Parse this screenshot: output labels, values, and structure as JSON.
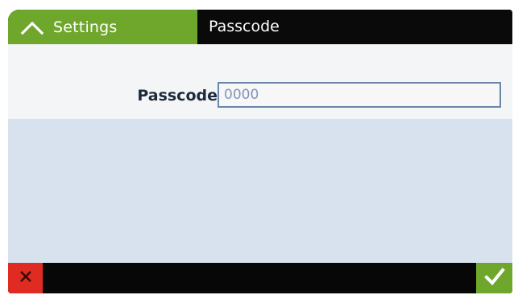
{
  "header": {
    "back_label": "Settings",
    "back_icon": "chevron-up-icon",
    "title": "Passcode"
  },
  "form": {
    "passcode_label": "Passcode",
    "passcode_value": "0000"
  },
  "footer": {
    "cancel_icon": "close-icon",
    "confirm_icon": "checkmark-icon"
  },
  "colors": {
    "accent_green": "#6fa62c",
    "cancel_red": "#e02b23",
    "content_background": "#d8e1ee",
    "bar_background": "#0a0a0a"
  }
}
